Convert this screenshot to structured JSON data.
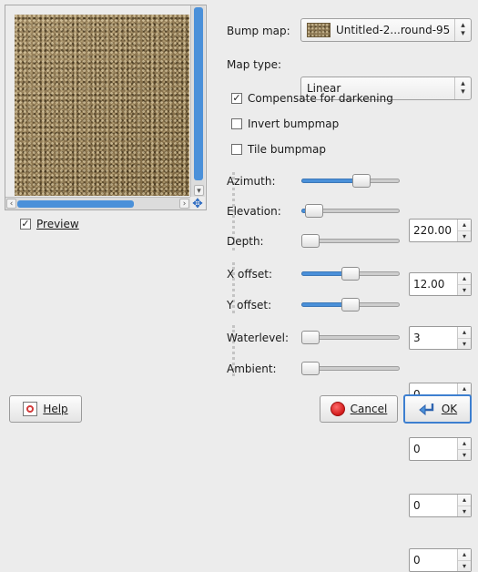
{
  "preview": {
    "checkbox_label": "Preview",
    "checked": true,
    "check_glyph": "☑"
  },
  "bump_map": {
    "label": "Bump map:",
    "value": "Untitled-2...round-95"
  },
  "map_type": {
    "label": "Map type:",
    "value": "Linear"
  },
  "options": [
    {
      "label": "Compensate for darkening",
      "checked": true
    },
    {
      "label": "Invert bumpmap",
      "checked": false
    },
    {
      "label": "Tile bumpmap",
      "checked": false
    }
  ],
  "params": [
    {
      "label": "Azimuth:",
      "value": "220.00",
      "fraction": 0.611
    },
    {
      "label": "Elevation:",
      "value": "12.00",
      "fraction": 0.133
    },
    {
      "label": "Depth:",
      "value": "3",
      "fraction": 0.04
    },
    {
      "label": "X offset:",
      "value": "0",
      "fraction": 0.5
    },
    {
      "label": "Y offset:",
      "value": "0",
      "fraction": 0.5
    },
    {
      "label": "Waterlevel:",
      "value": "0",
      "fraction": 0.0
    },
    {
      "label": "Ambient:",
      "value": "0",
      "fraction": 0.0
    }
  ],
  "buttons": {
    "help": "Help",
    "cancel": "Cancel",
    "ok": "OK"
  },
  "icons": {
    "help": "help-icon",
    "cancel": "cancel-icon",
    "ok": "ok-icon",
    "navigate": "navigate-icon"
  },
  "colors": {
    "accent": "#4a90d9",
    "default_border": "#3d7fd0"
  }
}
